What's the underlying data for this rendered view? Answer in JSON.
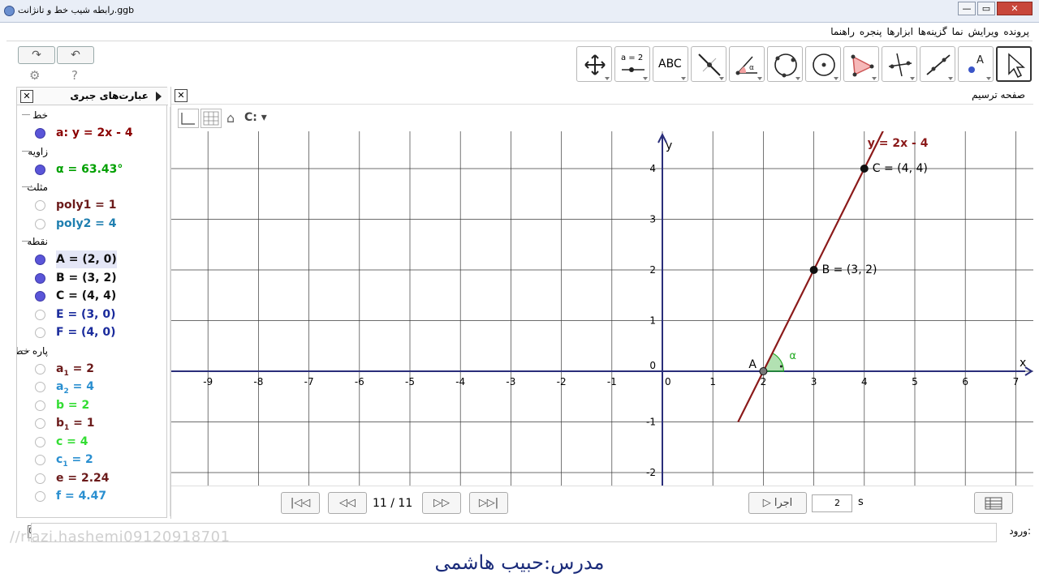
{
  "window": {
    "title": "رابطه شیب خط و تانژانت.ggb",
    "min": "—",
    "max": "▭",
    "close": "✕"
  },
  "menu": [
    "پرونده",
    "ویرایش",
    "نما",
    "گزینه‌ها",
    "ابزارها",
    "پنجره",
    "راهنما"
  ],
  "toolbar": {
    "undo": "↶",
    "redo": "↷",
    "settings": "⚙",
    "help": "?",
    "tools": [
      "move-graphics",
      "slider",
      "text",
      "perpendicular-line",
      "angle",
      "circle-three-points",
      "circle-center-point",
      "polygon",
      "perpendicular-bisector",
      "line",
      "point",
      "move"
    ],
    "slider_label": "a = 2",
    "text_label": "ABC",
    "angle_glyph": "α",
    "point_label": "A"
  },
  "algebra": {
    "title": "عبارت‌های جبری",
    "close": "✕",
    "groups": [
      {
        "label": "خط",
        "items": [
          {
            "text": "a: y = 2x - 4",
            "color": "#8b0000",
            "on": true
          }
        ]
      },
      {
        "label": "زاویه",
        "items": [
          {
            "text": "α = 63.43°",
            "color": "#00a000",
            "on": true
          }
        ]
      },
      {
        "label": "مثلث",
        "items": [
          {
            "text": "poly1 = 1",
            "color": "#6b1a1a",
            "on": false
          },
          {
            "text": "poly2 = 4",
            "color": "#1f7fb0",
            "on": false
          }
        ]
      },
      {
        "label": "نقطه",
        "items": [
          {
            "text": "A = (2, 0)",
            "color": "#111111",
            "on": true,
            "sel": true
          },
          {
            "text": "B = (3, 2)",
            "color": "#111111",
            "on": true
          },
          {
            "text": "C = (4, 4)",
            "color": "#111111",
            "on": true
          },
          {
            "text": "E = (3, 0)",
            "color": "#1a2b9c",
            "on": false
          },
          {
            "text": "F = (4, 0)",
            "color": "#1a2b9c",
            "on": false
          }
        ]
      },
      {
        "label": "پاره خط",
        "items": [
          {
            "text": "a",
            "sub": "1",
            "rest": " = 2",
            "color": "#6b1a1a",
            "on": false
          },
          {
            "text": "a",
            "sub": "2",
            "rest": " = 4",
            "color": "#2a8fd0",
            "on": false
          },
          {
            "text": "b = 2",
            "color": "#33dd33",
            "on": false
          },
          {
            "text": "b",
            "sub": "1",
            "rest": " = 1",
            "color": "#6b1a1a",
            "on": false
          },
          {
            "text": "c = 4",
            "color": "#33dd33",
            "on": false
          },
          {
            "text": "c",
            "sub": "1",
            "rest": " = 2",
            "color": "#2a8fd0",
            "on": false
          },
          {
            "text": "e = 2.24",
            "color": "#6b1a1a",
            "on": false
          },
          {
            "text": "f = 4.47",
            "color": "#2a8fd0",
            "on": false
          }
        ]
      }
    ]
  },
  "graphics": {
    "title": "صفحه ترسیم",
    "close": "✕",
    "view_menu": "C:",
    "xlabel": "x",
    "ylabel": "y",
    "x_ticks": [
      "-9",
      "-8",
      "-7",
      "-6",
      "-5",
      "-4",
      "-3",
      "-2",
      "-1",
      "0",
      "1",
      "2",
      "3",
      "4",
      "5",
      "6",
      "7"
    ],
    "y_ticks": [
      "4",
      "3",
      "2",
      "1",
      "0",
      "-1",
      "-2"
    ],
    "line_label": "y = 2x - 4",
    "points": [
      {
        "name": "A",
        "label": "A",
        "x": 2,
        "y": 0
      },
      {
        "name": "B",
        "label": "B = (3, 2)",
        "x": 3,
        "y": 2
      },
      {
        "name": "C",
        "label": "C = (4, 4)",
        "x": 4,
        "y": 4
      }
    ],
    "angle_label": "α",
    "colors": {
      "line": "#8b1a1a",
      "axis": "#2a2e7a",
      "grid": "#3b3b3b",
      "angle": "#22aa22",
      "point": "#111111"
    }
  },
  "navbar": {
    "first": "|◁◁",
    "prev": "◁◁",
    "counter": "11 / 11",
    "next": "▷▷",
    "last": "▷▷|",
    "play": "▷ اجرا",
    "speed": "2",
    "speed_unit": "s"
  },
  "input": {
    "label": "ورود:"
  },
  "watermark": "//riazi.hashemi09120918701",
  "caption": "مدرس:حبیب هاشمی"
}
